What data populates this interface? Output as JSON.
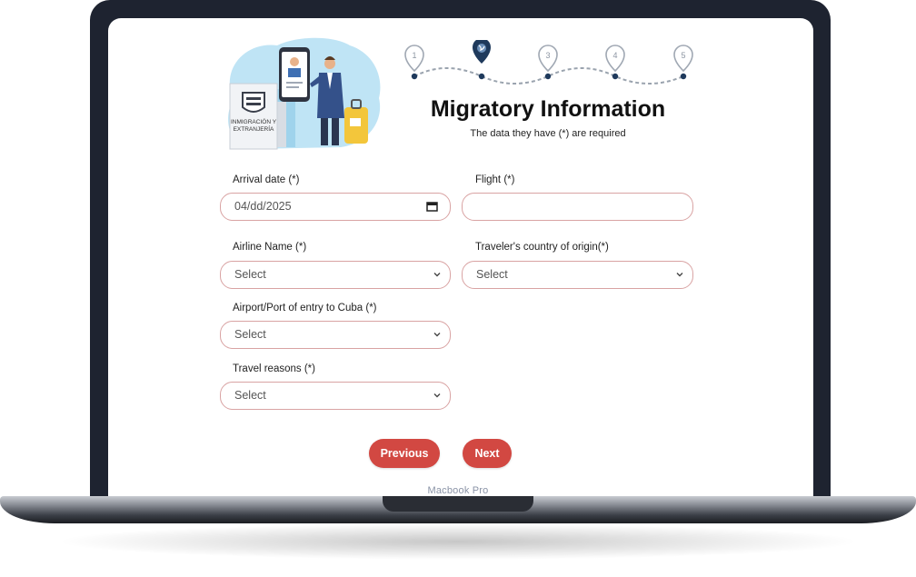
{
  "device": {
    "label": "Macbook Pro"
  },
  "illustration": {
    "badge_text_line1": "INMIGRACIÓN Y",
    "badge_text_line2": "EXTRANJERÍA"
  },
  "stepper": {
    "steps": [
      "1",
      "2",
      "3",
      "4",
      "5"
    ],
    "active_step": 2,
    "active_icon": "globe-icon"
  },
  "header": {
    "title": "Migratory Information",
    "subtitle": "The data they have (*) are required"
  },
  "form": {
    "arrival_date": {
      "label": "Arrival date (*)",
      "value": "04/dd/2025"
    },
    "flight": {
      "label": "Flight (*)",
      "value": ""
    },
    "airline": {
      "label": "Airline Name (*)",
      "value": "Select"
    },
    "origin_country": {
      "label": "Traveler's country of origin(*)",
      "value": "Select"
    },
    "airport": {
      "label": "Airport/Port of entry to Cuba (*)",
      "value": "Select"
    },
    "travel_reasons": {
      "label": "Travel reasons (*)",
      "value": "Select"
    }
  },
  "actions": {
    "previous_label": "Previous",
    "next_label": "Next"
  },
  "colors": {
    "accent": "#d24842",
    "field_border": "#d9a3a3",
    "stepper_dot": "#1f3a5c",
    "bezel": "#1e2330"
  }
}
